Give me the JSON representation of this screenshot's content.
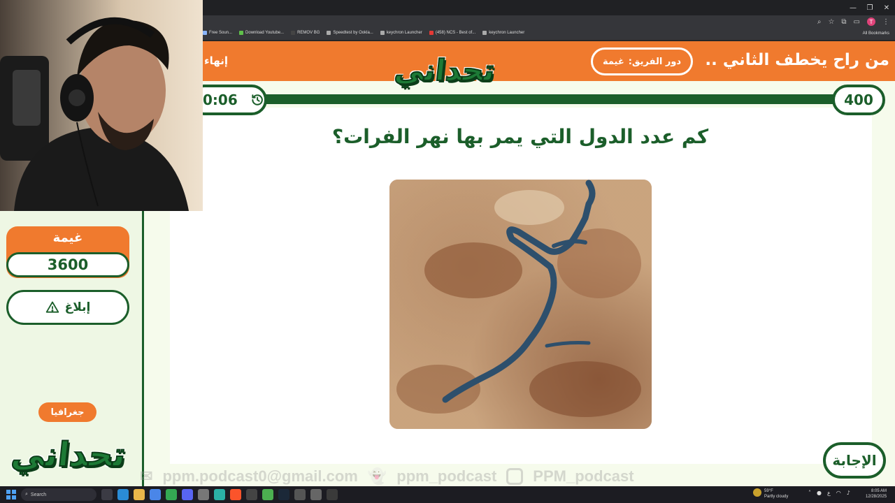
{
  "browser": {
    "bookmarks": [
      "Free Soun...",
      "Download Youtube...",
      "REMOV BG",
      "Speedtest by Ookla...",
      "keychron Launcher",
      "(458) NCS - Best of...",
      "keychron Launcher"
    ],
    "all_bookmarks_label": "All Bookmarks",
    "profile_initial": "T"
  },
  "header": {
    "question_title": "من راح يخطف الثاني ..",
    "team_turn_label": "دور الفريق:",
    "team_turn_value": "غيمة",
    "end_label": "إنهاء",
    "logo_text": "تحداني"
  },
  "game": {
    "points": "400",
    "timer": "0:06",
    "question": "كم عدد الدول التي يمر بها نهر الفرات؟",
    "answer_label": "الإجابة"
  },
  "sidebar": {
    "team_name": "غيمة",
    "team_score": "3600",
    "report_label": "إبلاغ",
    "category": "جغرافيا",
    "logo_text": "تحداني"
  },
  "watermark": {
    "email": "ppm.podcast0@gmail.com",
    "snapchat": "ppm_podcast",
    "instagram": "PPM_podcast"
  },
  "taskbar": {
    "search_placeholder": "Search",
    "weather_temp": "59°F",
    "weather_desc": "Partly cloudy",
    "time": "8:05 AM",
    "date": "12/28/2025",
    "lang": "ع"
  },
  "colors": {
    "orange": "#f07a2e",
    "green_dark": "#1b5e2a",
    "page_bg": "#eef7e4"
  }
}
